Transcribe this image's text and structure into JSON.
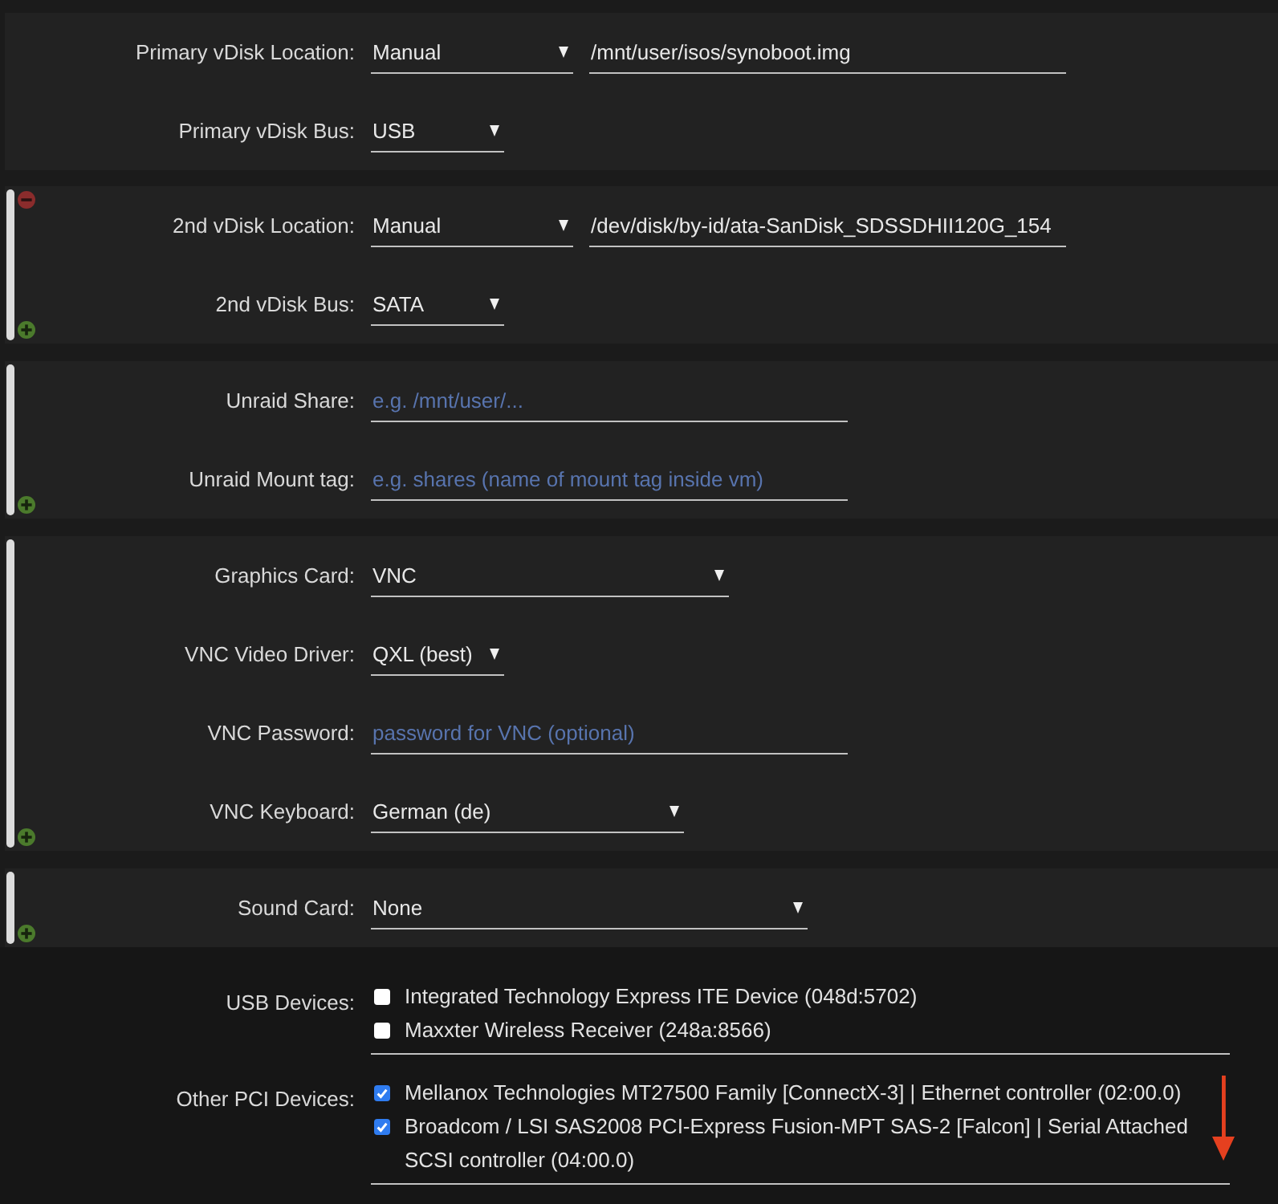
{
  "sections": [
    {
      "kind": "panel",
      "removable": false,
      "addable": false,
      "fields": [
        {
          "kind": "select",
          "label": "Primary vDisk Location:",
          "value": "Manual",
          "path": "/mnt/user/isos/synoboot.img"
        },
        {
          "kind": "select",
          "label": "Primary vDisk Bus:",
          "value": "USB"
        }
      ]
    },
    {
      "kind": "panel",
      "removable": true,
      "addable": true,
      "fields": [
        {
          "kind": "select",
          "label": "2nd vDisk Location:",
          "value": "Manual",
          "path": "/dev/disk/by-id/ata-SanDisk_SDSSDHII120G_154"
        },
        {
          "kind": "select",
          "label": "2nd vDisk Bus:",
          "value": "SATA"
        }
      ]
    },
    {
      "kind": "panel",
      "removable": false,
      "addable": true,
      "fields": [
        {
          "kind": "text",
          "label": "Unraid Share:",
          "placeholder": "e.g. /mnt/user/..."
        },
        {
          "kind": "text",
          "label": "Unraid Mount tag:",
          "placeholder": "e.g. shares (name of mount tag inside vm)"
        }
      ]
    },
    {
      "kind": "panel",
      "removable": false,
      "addable": true,
      "fields": [
        {
          "kind": "select",
          "label": "Graphics Card:",
          "value": "VNC"
        },
        {
          "kind": "select",
          "label": "VNC Video Driver:",
          "value": "QXL (best)"
        },
        {
          "kind": "text",
          "label": "VNC Password:",
          "placeholder": "password for VNC (optional)"
        },
        {
          "kind": "select",
          "label": "VNC Keyboard:",
          "value": "German (de)"
        }
      ]
    },
    {
      "kind": "panel",
      "removable": false,
      "addable": true,
      "fields": [
        {
          "kind": "select",
          "label": "Sound Card:",
          "value": "None"
        }
      ]
    },
    {
      "kind": "plain",
      "fields": [
        {
          "kind": "checklist",
          "label": "USB Devices:",
          "items": [
            {
              "label": "Integrated Technology Express ITE Device (048d:5702)",
              "checked": false
            },
            {
              "label": "Maxxter Wireless Receiver (248a:8566)",
              "checked": false
            }
          ]
        },
        {
          "kind": "checklist",
          "label": "Other PCI Devices:",
          "items": [
            {
              "label": "Mellanox Technologies MT27500 Family [ConnectX-3] | Ethernet controller (02:00.0)",
              "checked": true
            },
            {
              "label": "Broadcom / LSI SAS2008 PCI-Express Fusion-MPT SAS-2 [Falcon] | Serial Attached SCSI controller (04:00.0)",
              "checked": true
            }
          ]
        }
      ]
    }
  ]
}
